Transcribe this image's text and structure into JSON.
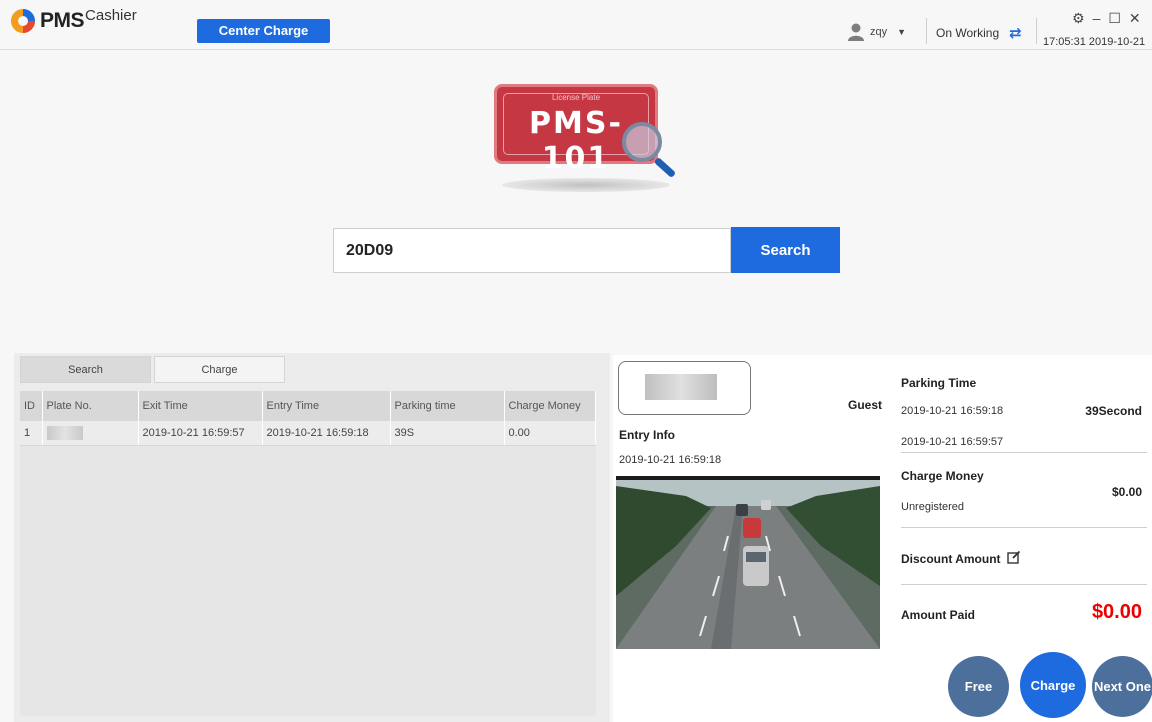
{
  "app": {
    "name": "PMS",
    "subname": "Cashier"
  },
  "header": {
    "center_charge": "Center Charge",
    "user": "zqy",
    "status": "On Working",
    "clock": "17:05:31 2019-10-21"
  },
  "logo": {
    "plate_caption": "License Plate",
    "plate_number": "PMS-101"
  },
  "search": {
    "value": "20D09",
    "button": "Search"
  },
  "tabs": [
    {
      "label": "Search"
    },
    {
      "label": "Charge"
    }
  ],
  "table": {
    "headers": [
      "ID",
      "Plate No.",
      "Exit Time",
      "Entry Time",
      "Parking time",
      "Charge Money"
    ],
    "rows": [
      {
        "id": "1",
        "plate": "",
        "exit_time": "2019-10-21 16:59:57",
        "entry_time": "2019-10-21 16:59:18",
        "parking_time": "39S",
        "charge_money": "0.00"
      }
    ]
  },
  "entry": {
    "user_type": "Guest",
    "title": "Entry Info",
    "time": "2019-10-21 16:59:18"
  },
  "details": {
    "parking_time_label": "Parking Time",
    "entry_time": "2019-10-21 16:59:18",
    "exit_time": "2019-10-21 16:59:57",
    "duration": "39Second",
    "charge_money_label": "Charge Money",
    "registration": "Unregistered",
    "charge_money": "$0.00",
    "discount_label": "Discount Amount",
    "amount_paid_label": "Amount Paid",
    "amount_paid": "$0.00"
  },
  "actions": {
    "free": "Free",
    "charge": "Charge",
    "next": "Next One"
  },
  "colors": {
    "accent": "#1e6be0",
    "secondary": "#4d6f9b",
    "alert": "#ee0000",
    "plate": "#c53843"
  }
}
